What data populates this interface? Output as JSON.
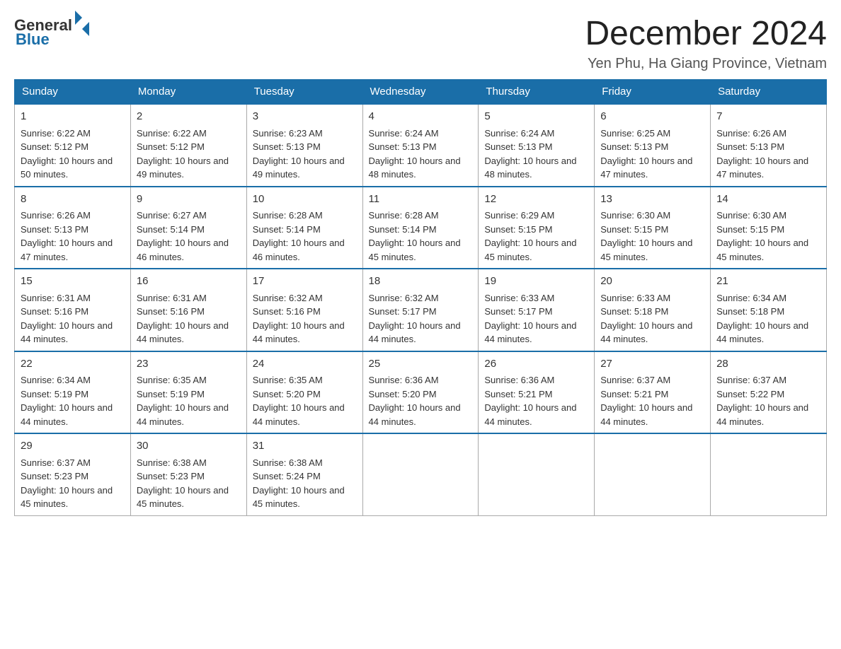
{
  "header": {
    "logo": {
      "general": "General",
      "blue": "Blue"
    },
    "title": "December 2024",
    "location": "Yen Phu, Ha Giang Province, Vietnam"
  },
  "days_of_week": [
    "Sunday",
    "Monday",
    "Tuesday",
    "Wednesday",
    "Thursday",
    "Friday",
    "Saturday"
  ],
  "weeks": [
    [
      {
        "day": "1",
        "sunrise": "6:22 AM",
        "sunset": "5:12 PM",
        "daylight": "10 hours and 50 minutes."
      },
      {
        "day": "2",
        "sunrise": "6:22 AM",
        "sunset": "5:12 PM",
        "daylight": "10 hours and 49 minutes."
      },
      {
        "day": "3",
        "sunrise": "6:23 AM",
        "sunset": "5:13 PM",
        "daylight": "10 hours and 49 minutes."
      },
      {
        "day": "4",
        "sunrise": "6:24 AM",
        "sunset": "5:13 PM",
        "daylight": "10 hours and 48 minutes."
      },
      {
        "day": "5",
        "sunrise": "6:24 AM",
        "sunset": "5:13 PM",
        "daylight": "10 hours and 48 minutes."
      },
      {
        "day": "6",
        "sunrise": "6:25 AM",
        "sunset": "5:13 PM",
        "daylight": "10 hours and 47 minutes."
      },
      {
        "day": "7",
        "sunrise": "6:26 AM",
        "sunset": "5:13 PM",
        "daylight": "10 hours and 47 minutes."
      }
    ],
    [
      {
        "day": "8",
        "sunrise": "6:26 AM",
        "sunset": "5:13 PM",
        "daylight": "10 hours and 47 minutes."
      },
      {
        "day": "9",
        "sunrise": "6:27 AM",
        "sunset": "5:14 PM",
        "daylight": "10 hours and 46 minutes."
      },
      {
        "day": "10",
        "sunrise": "6:28 AM",
        "sunset": "5:14 PM",
        "daylight": "10 hours and 46 minutes."
      },
      {
        "day": "11",
        "sunrise": "6:28 AM",
        "sunset": "5:14 PM",
        "daylight": "10 hours and 45 minutes."
      },
      {
        "day": "12",
        "sunrise": "6:29 AM",
        "sunset": "5:15 PM",
        "daylight": "10 hours and 45 minutes."
      },
      {
        "day": "13",
        "sunrise": "6:30 AM",
        "sunset": "5:15 PM",
        "daylight": "10 hours and 45 minutes."
      },
      {
        "day": "14",
        "sunrise": "6:30 AM",
        "sunset": "5:15 PM",
        "daylight": "10 hours and 45 minutes."
      }
    ],
    [
      {
        "day": "15",
        "sunrise": "6:31 AM",
        "sunset": "5:16 PM",
        "daylight": "10 hours and 44 minutes."
      },
      {
        "day": "16",
        "sunrise": "6:31 AM",
        "sunset": "5:16 PM",
        "daylight": "10 hours and 44 minutes."
      },
      {
        "day": "17",
        "sunrise": "6:32 AM",
        "sunset": "5:16 PM",
        "daylight": "10 hours and 44 minutes."
      },
      {
        "day": "18",
        "sunrise": "6:32 AM",
        "sunset": "5:17 PM",
        "daylight": "10 hours and 44 minutes."
      },
      {
        "day": "19",
        "sunrise": "6:33 AM",
        "sunset": "5:17 PM",
        "daylight": "10 hours and 44 minutes."
      },
      {
        "day": "20",
        "sunrise": "6:33 AM",
        "sunset": "5:18 PM",
        "daylight": "10 hours and 44 minutes."
      },
      {
        "day": "21",
        "sunrise": "6:34 AM",
        "sunset": "5:18 PM",
        "daylight": "10 hours and 44 minutes."
      }
    ],
    [
      {
        "day": "22",
        "sunrise": "6:34 AM",
        "sunset": "5:19 PM",
        "daylight": "10 hours and 44 minutes."
      },
      {
        "day": "23",
        "sunrise": "6:35 AM",
        "sunset": "5:19 PM",
        "daylight": "10 hours and 44 minutes."
      },
      {
        "day": "24",
        "sunrise": "6:35 AM",
        "sunset": "5:20 PM",
        "daylight": "10 hours and 44 minutes."
      },
      {
        "day": "25",
        "sunrise": "6:36 AM",
        "sunset": "5:20 PM",
        "daylight": "10 hours and 44 minutes."
      },
      {
        "day": "26",
        "sunrise": "6:36 AM",
        "sunset": "5:21 PM",
        "daylight": "10 hours and 44 minutes."
      },
      {
        "day": "27",
        "sunrise": "6:37 AM",
        "sunset": "5:21 PM",
        "daylight": "10 hours and 44 minutes."
      },
      {
        "day": "28",
        "sunrise": "6:37 AM",
        "sunset": "5:22 PM",
        "daylight": "10 hours and 44 minutes."
      }
    ],
    [
      {
        "day": "29",
        "sunrise": "6:37 AM",
        "sunset": "5:23 PM",
        "daylight": "10 hours and 45 minutes."
      },
      {
        "day": "30",
        "sunrise": "6:38 AM",
        "sunset": "5:23 PM",
        "daylight": "10 hours and 45 minutes."
      },
      {
        "day": "31",
        "sunrise": "6:38 AM",
        "sunset": "5:24 PM",
        "daylight": "10 hours and 45 minutes."
      },
      null,
      null,
      null,
      null
    ]
  ]
}
